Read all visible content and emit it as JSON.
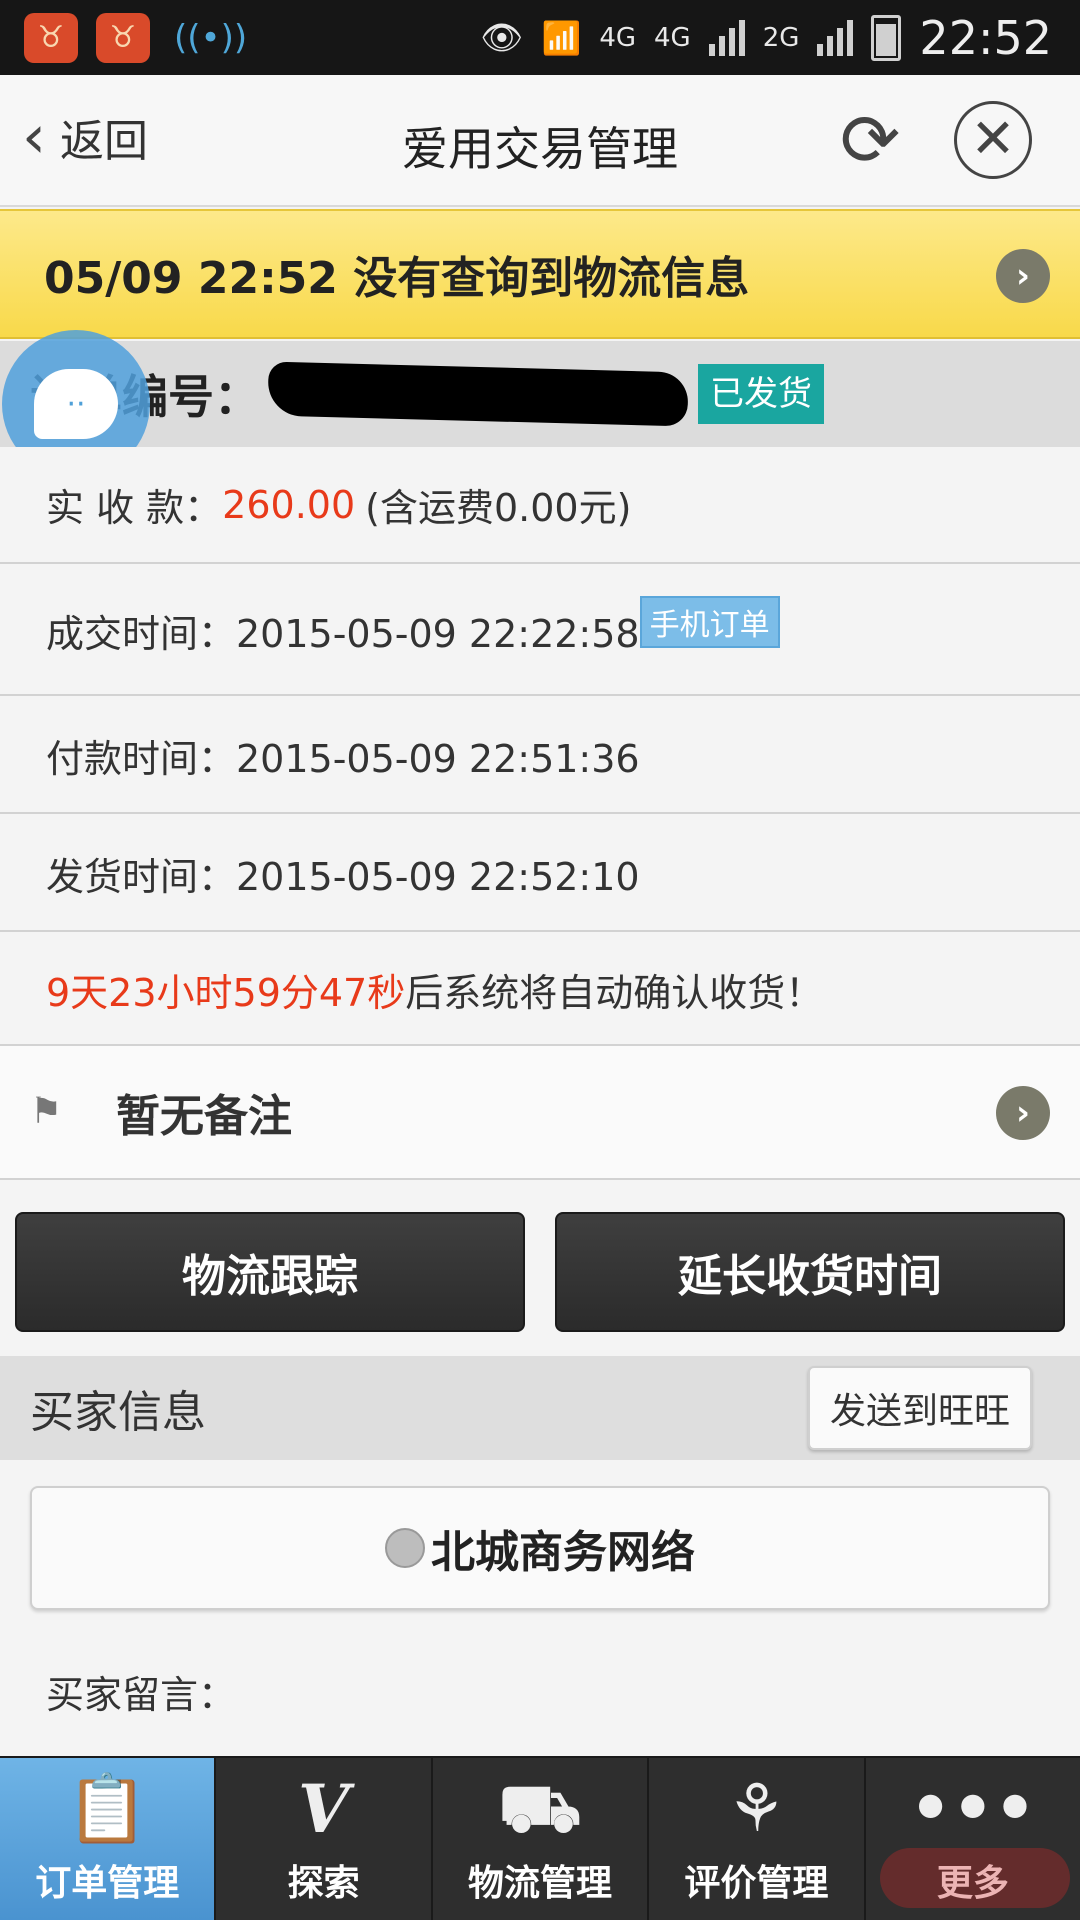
{
  "status_bar": {
    "network_labels": [
      "4G",
      "4G",
      "2G"
    ],
    "time": "22:52"
  },
  "navbar": {
    "back_label": "返回",
    "title": "爱用交易管理"
  },
  "logistics_banner": {
    "text": "05/09 22:52 没有查询到物流信息"
  },
  "order": {
    "label": "订单编号：",
    "status_badge": "已发货"
  },
  "details": {
    "amount_label": "实 收 款：",
    "amount_value": "260.00",
    "amount_note": "(含运费0.00元)",
    "deal_time": "成交时间：2015-05-09 22:22:58",
    "mobile_badge": "手机订单",
    "pay_time": "付款时间：2015-05-09 22:51:36",
    "ship_time": "发货时间：2015-05-09 22:52:10",
    "countdown": "9天23小时59分47秒",
    "countdown_suffix": "后系统将自动确认收货！"
  },
  "remark": {
    "text": "暂无备注"
  },
  "actions": {
    "track_label": "物流跟踪",
    "extend_label": "延长收货时间"
  },
  "buyer": {
    "title": "买家信息",
    "send_ww_label": "发送到旺旺",
    "name": "北城商务网络",
    "message_label": "买家留言："
  },
  "tabs": [
    {
      "label": "订单管理",
      "icon": "clipboard-icon",
      "active": true
    },
    {
      "label": "探索",
      "icon": "v-icon",
      "active": false
    },
    {
      "label": "物流管理",
      "icon": "truck-icon",
      "active": false
    },
    {
      "label": "评价管理",
      "icon": "flower-icon",
      "active": false
    },
    {
      "label": "更多",
      "icon": "more-dots-icon",
      "active": false
    }
  ],
  "colors": {
    "accent_red": "#e83a1a",
    "banner_yellow": "#f8d94a",
    "badge_teal": "#1aa6a0",
    "active_tab_blue": "#4a93d0"
  }
}
